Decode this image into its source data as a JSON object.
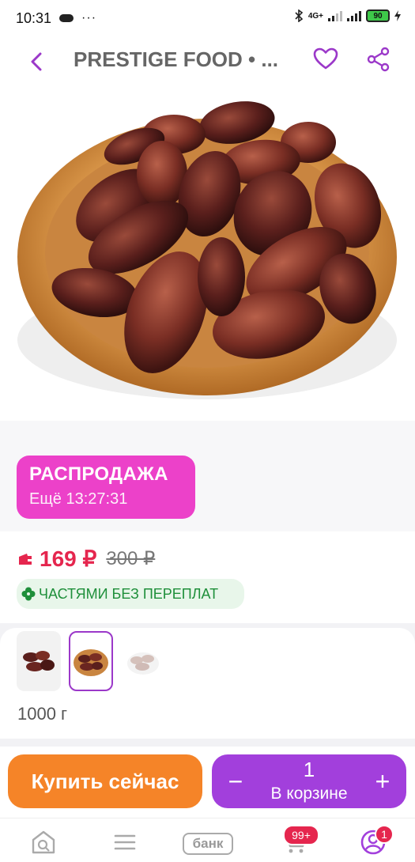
{
  "status_bar": {
    "time": "10:31",
    "dots": "···",
    "network": "4G+",
    "battery": "90"
  },
  "header": {
    "title": "PRESTIGE FOOD • ...",
    "back_icon": "chevron-left-icon",
    "favorite_icon": "heart-icon",
    "share_icon": "share-icon",
    "accent_color": "#9b38c9"
  },
  "sale": {
    "label": "РАСПРОДАЖА",
    "timer": "Ещё 13:27:31",
    "color": "#ec41c9"
  },
  "price": {
    "current": "169 ₽",
    "old": "300 ₽",
    "installment": "ЧАСТЯМИ БЕЗ ПЕРЕПЛАТ",
    "price_color": "#e5264e"
  },
  "variants": {
    "selected_label": "1000 г"
  },
  "actions": {
    "buy_now": "Купить сейчас",
    "quantity": "1",
    "in_cart": "В корзине",
    "minus": "−",
    "plus": "+",
    "buy_color": "#f58428",
    "cart_color": "#a23fdc"
  },
  "bottom_nav": {
    "bank_label": "банк",
    "cart_badge": "99+",
    "profile_badge": "1"
  }
}
